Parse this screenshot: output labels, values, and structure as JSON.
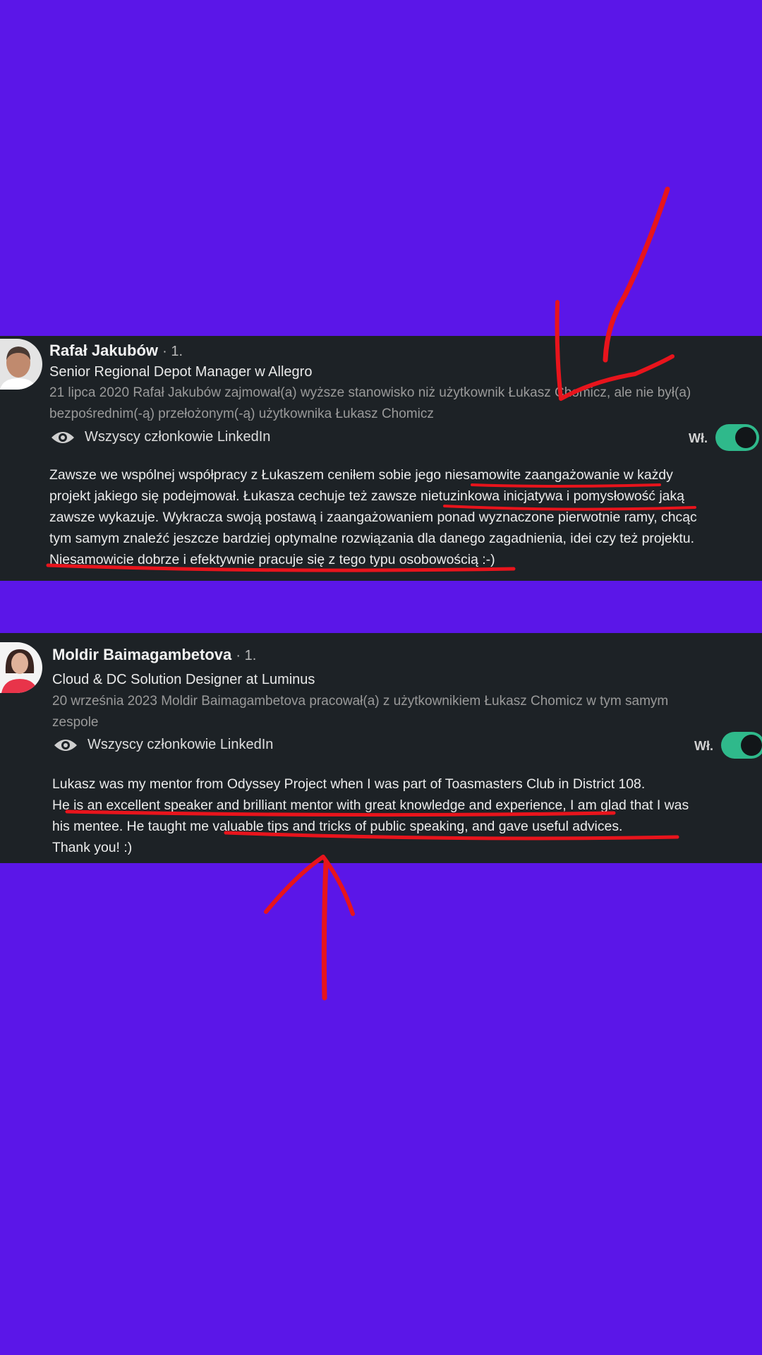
{
  "recommendations": [
    {
      "name": "Rafał Jakubów",
      "degree": "· 1.",
      "headline": "Senior Regional Depot Manager w Allegro",
      "meta_lines": [
        "21 lipca 2020 Rafał Jakubów zajmował(a) wyższe stanowisko niż użytkownik Łukasz Chomicz, ale nie był(a)",
        "bezpośrednim(-ą) przełożonym(-ą) użytkownika Łukasz Chomicz"
      ],
      "visibility": "Wszyscy członkowie LinkedIn",
      "toggle_label": "Wł.",
      "toggle_on": true,
      "text_lines": [
        "Zawsze we wspólnej współpracy z Łukaszem ceniłem sobie jego niesamowite zaangażowanie w każdy",
        "projekt jakiego się podejmował. Łukasza cechuje też zawsze nietuzinkowa inicjatywa i pomysłowość jaką",
        "zawsze wykazuje. Wykracza swoją postawą i zaangażowaniem ponad wyznaczone pierwotnie ramy, chcąc",
        "tym samym znaleźć jeszcze bardziej optymalne rozwiązania dla danego zagadnienia, idei czy też projektu.",
        "Niesamowicie dobrze i efektywnie pracuje się z tego typu osobowością :-)"
      ]
    },
    {
      "name": "Moldir Baimagambetova",
      "degree": "· 1.",
      "headline": "Cloud & DC Solution Designer at Luminus",
      "meta_lines": [
        "20 września 2023 Moldir Baimagambetova pracował(a) z użytkownikiem Łukasz Chomicz w tym samym",
        "zespole"
      ],
      "visibility": "Wszyscy członkowie LinkedIn",
      "toggle_label": "Wł.",
      "toggle_on": true,
      "text_lines": [
        "Lukasz was my mentor from Odyssey Project when I was part of Toasmasters Club in District 108.",
        "He is an excellent speaker and brilliant mentor with great knowledge and experience, I am glad that I was",
        "his mentee. He taught me valuable tips and tricks of public speaking, and gave useful advices.",
        "Thank you! :)"
      ]
    }
  ],
  "colors": {
    "background": "#5b16e8",
    "card": "#1d2226",
    "toggle": "#2fb98b",
    "annotation": "#e8141c"
  },
  "icons": [
    "eye-icon"
  ]
}
